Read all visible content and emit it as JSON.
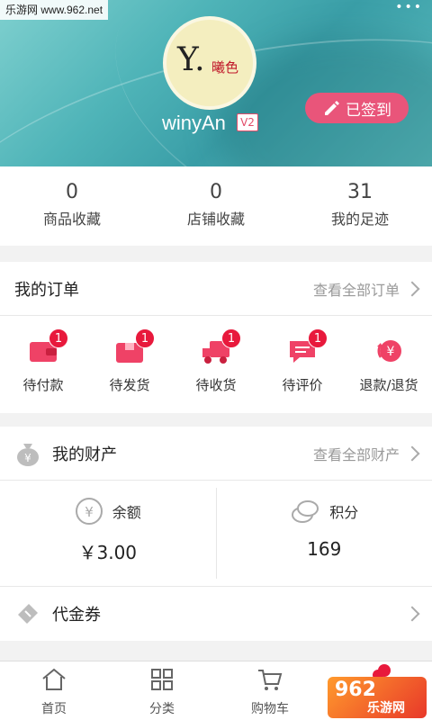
{
  "watermark": "乐游网 www.962.net",
  "profile": {
    "username": "winyAn",
    "level": "V2",
    "signin_label": "已签到",
    "avatar_sig": "Y.",
    "avatar_sig2": "曦色"
  },
  "stats": [
    {
      "value": "0",
      "label": "商品收藏"
    },
    {
      "value": "0",
      "label": "店铺收藏"
    },
    {
      "value": "31",
      "label": "我的足迹"
    }
  ],
  "orders": {
    "title": "我的订单",
    "link": "查看全部订单",
    "items": [
      {
        "label": "待付款",
        "badge": "1",
        "icon": "wallet-icon"
      },
      {
        "label": "待发货",
        "badge": "1",
        "icon": "package-icon"
      },
      {
        "label": "待收货",
        "badge": "1",
        "icon": "truck-icon"
      },
      {
        "label": "待评价",
        "badge": "1",
        "icon": "comment-icon"
      },
      {
        "label": "退款/退货",
        "badge": "",
        "icon": "refund-icon"
      }
    ]
  },
  "wealth": {
    "title": "我的财产",
    "link": "查看全部财产",
    "balance_label": "余额",
    "balance_value": "￥3.00",
    "points_label": "积分",
    "points_value": "169"
  },
  "coupon": {
    "label": "代金券"
  },
  "tabs": [
    {
      "label": "首页",
      "icon": "home-icon"
    },
    {
      "label": "分类",
      "icon": "category-icon"
    },
    {
      "label": "购物车",
      "icon": "cart-icon"
    },
    {
      "label": "",
      "icon": "user-icon"
    }
  ],
  "logo_watermark": {
    "a": "962",
    "b": "乐游网"
  },
  "colors": {
    "accent": "#e9557a",
    "badge": "#e8193c",
    "header": "#4fb4b8"
  }
}
